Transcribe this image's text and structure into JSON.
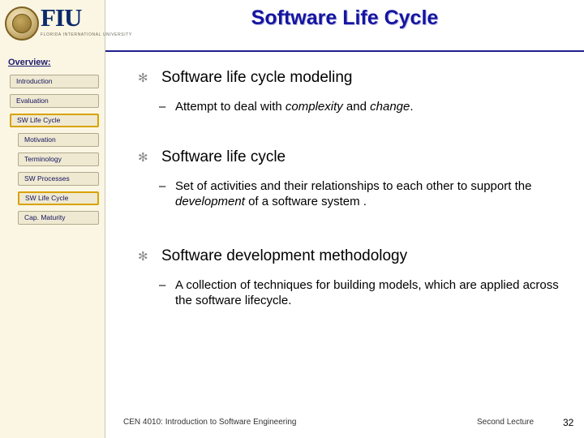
{
  "header": {
    "title": "Software Life Cycle",
    "logo_text": "FIU",
    "logo_subtitle": "FLORIDA INTERNATIONAL UNIVERSITY",
    "logo_icon": "university-seal-icon"
  },
  "sidebar": {
    "title": "Overview:",
    "items": [
      {
        "label": "Introduction",
        "highlighted": false,
        "indent": false
      },
      {
        "label": "Evaluation",
        "highlighted": false,
        "indent": false
      },
      {
        "label": "SW Life Cycle",
        "highlighted": true,
        "indent": false
      },
      {
        "label": "Motivation",
        "highlighted": false,
        "indent": true
      },
      {
        "label": "Terminology",
        "highlighted": false,
        "indent": true
      },
      {
        "label": "SW Processes",
        "highlighted": false,
        "indent": true
      },
      {
        "label": "SW Life Cycle",
        "highlighted": true,
        "indent": true
      },
      {
        "label": "Cap. Maturity",
        "highlighted": false,
        "indent": true
      }
    ]
  },
  "content": {
    "bullets": [
      {
        "level1": "Software life cycle modeling",
        "sub": [
          {
            "prefix": "Attempt to deal with ",
            "italic1": "complexity",
            "middle": " and ",
            "italic2": "change",
            "suffix": "."
          }
        ]
      },
      {
        "level1": "Software life cycle",
        "sub": [
          {
            "prefix": "Set of activities and their relationships to each other to support the ",
            "italic1": "development",
            "middle": " of a software system .",
            "italic2": "",
            "suffix": ""
          }
        ]
      },
      {
        "level1": "Software development methodology",
        "sub": [
          {
            "prefix": "A collection of techniques for building models, which are applied across the software lifecycle.",
            "italic1": "",
            "middle": "",
            "italic2": "",
            "suffix": ""
          }
        ]
      }
    ],
    "bullet_mark": "✻",
    "sub_dash": "–"
  },
  "footer": {
    "course": "CEN 4010: Introduction to Software Engineering",
    "lecture": "Second Lecture",
    "page_number": "32"
  },
  "colors": {
    "title": "#1515a0",
    "sidebar_bg": "#fbf6e4",
    "highlight_border": "#d8a200",
    "header_rule": "#1f1f8f"
  }
}
